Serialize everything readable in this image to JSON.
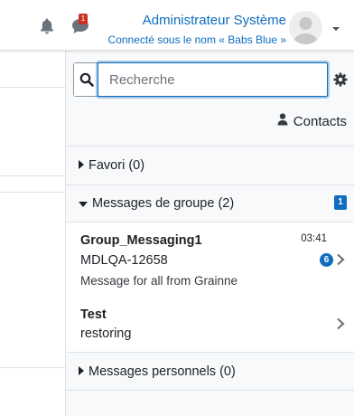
{
  "header": {
    "user_name": "Administrateur Système",
    "login_info": "Connecté sous le nom « Babs Blue »",
    "messages_badge": "1"
  },
  "drawer": {
    "search_placeholder": "Recherche",
    "contacts_label": "Contacts",
    "sections": {
      "favourites": "Favori (0)",
      "group": "Messages de groupe (2)",
      "group_unread": "1",
      "private": "Messages personnels (0)"
    },
    "conversations": [
      {
        "title": "Group_Messaging1",
        "subtitle": "MDLQA-12658",
        "last_message": "Message for all from Grainne",
        "time": "03:41",
        "unread_count": "6"
      },
      {
        "title": "Test",
        "subtitle": "restoring"
      }
    ]
  },
  "colors": {
    "accent": "#0f6cbf",
    "badge_red": "#ca3120",
    "drawer_bg": "#f8f9fa",
    "border": "#dee2e6"
  },
  "icons": [
    "bell-icon",
    "chat-icon",
    "avatar-icon",
    "caret-down-icon",
    "search-icon",
    "gear-icon",
    "user-icon",
    "caret-right-icon",
    "chevron-right-icon"
  ]
}
